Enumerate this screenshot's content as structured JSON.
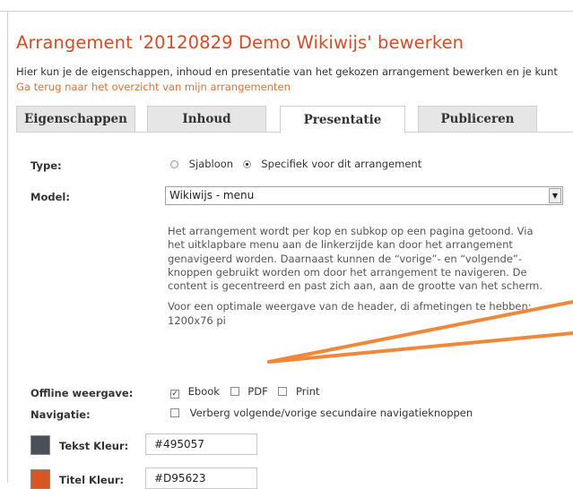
{
  "header": {
    "title": "Arrangement '20120829 Demo Wikiwijs' bewerken",
    "intro": "Hier kun je de eigenschappen, inhoud en presentatie van het gekozen arrangement bewerken en je kunt",
    "back_link": "Ga terug naar het overzicht van mijn arrangementen"
  },
  "tabs": [
    {
      "label": "Eigenschappen",
      "active": false
    },
    {
      "label": "Inhoud",
      "active": false
    },
    {
      "label": "Presentatie",
      "active": true
    },
    {
      "label": "Publiceren",
      "active": false
    }
  ],
  "form": {
    "type": {
      "label": "Type:",
      "options": [
        {
          "label": "Sjabloon",
          "selected": false
        },
        {
          "label": "Specifiek voor dit arrangement",
          "selected": true
        }
      ]
    },
    "model": {
      "label": "Model:",
      "value": "Wikiwijs - menu",
      "description": [
        "Het arrangement wordt per kop en subkop op een pagina getoond. Via het uitklapbare menu aan de linkerzijde kan door het arrangement genavigeerd worden. Daarnaast kunnen de “vorige”- en “volgende”-knoppen gebruikt worden om door het arrangement te navigeren. De content is gecentreerd en past zich aan, aan de grootte van het scherm.",
        "Voor een optimale weergave van de header, di afmetingen te hebben: 1200x76 pi"
      ]
    },
    "offline": {
      "label": "Offline weergave:",
      "options": [
        {
          "label": "Ebook",
          "checked": true
        },
        {
          "label": "PDF",
          "checked": false
        },
        {
          "label": "Print",
          "checked": false
        }
      ]
    },
    "navigatie": {
      "label": "Navigatie:",
      "option": {
        "label": "Verberg volgende/vorige secundaire navigatieknoppen",
        "checked": false
      }
    },
    "colors": [
      {
        "label": "Tekst Kleur:",
        "value": "#495057",
        "swatch": "#495057"
      },
      {
        "label": "Titel Kleur:",
        "value": "#D95623",
        "swatch": "#D95623"
      }
    ]
  },
  "theme": {
    "accent": "#d14d28",
    "link": "#e07030",
    "annotation": "#f0883c"
  }
}
